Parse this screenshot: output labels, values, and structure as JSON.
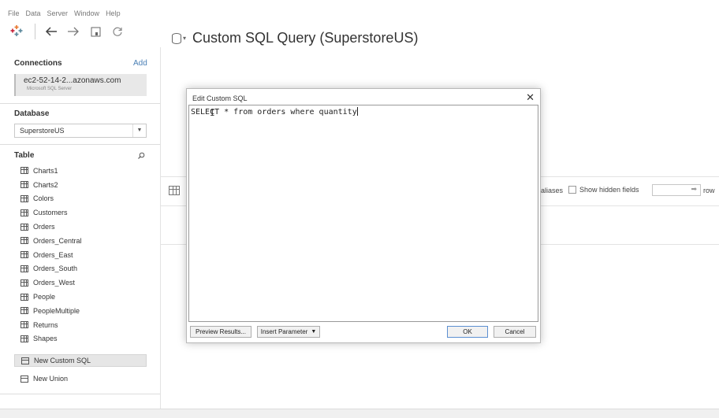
{
  "menu": [
    "File",
    "Data",
    "Server",
    "Window",
    "Help"
  ],
  "toolbar": {
    "icons": [
      "tableau-logo-icon",
      "back-arrow-icon",
      "forward-arrow-icon",
      "save-icon",
      "refresh-icon"
    ]
  },
  "left": {
    "connections_title": "Connections",
    "add_label": "Add",
    "connection": {
      "name": "ec2-52-14-2...azonaws.com",
      "type": "Microsoft SQL Server"
    },
    "database_title": "Database",
    "database_value": "SuperstoreUS",
    "table_title": "Table",
    "tables": [
      "Charts1",
      "Charts2",
      "Colors",
      "Customers",
      "Orders",
      "Orders_Central",
      "Orders_East",
      "Orders_South",
      "Orders_West",
      "People",
      "PeopleMultiple",
      "Returns",
      "Shapes"
    ],
    "new_custom_sql": "New Custom SQL",
    "new_union": "New Union"
  },
  "main": {
    "title": "Custom SQL Query (SuperstoreUS)",
    "aliases_label": "aliases",
    "show_hidden_fields": "Show hidden fields",
    "rows_label": "row"
  },
  "dialog": {
    "title": "Edit Custom SQL",
    "sql": "SELECT * from orders where quantity",
    "preview_button": "Preview Results...",
    "insert_parameter_button": "Insert Parameter",
    "ok_button": "OK",
    "cancel_button": "Cancel"
  },
  "colors": {
    "accent": "#4a7fb5",
    "ok_border": "#5c8fd1"
  }
}
